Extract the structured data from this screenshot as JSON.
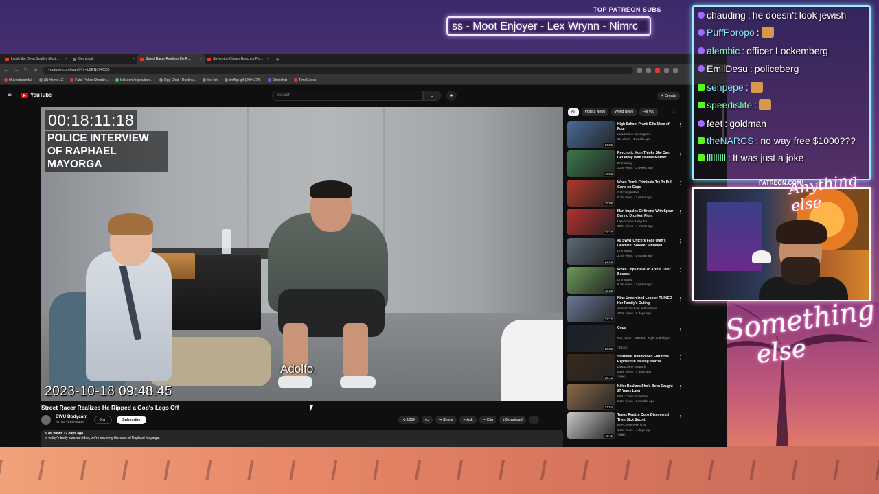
{
  "overlay": {
    "patreon_label": "TOP PATREON SUBS",
    "ticker_text": "ss - Moot Enjoyer - Lex Wrynn - Nimrc",
    "webcam_patreon": "PATREON.COM/",
    "webcam_brand": "Anything else",
    "logo_line1": "Something",
    "logo_line2": "else"
  },
  "chat": {
    "messages": [
      {
        "user": "chauding",
        "text": "he doesn't look jewish",
        "platform": "t"
      },
      {
        "user": "PuffPoropo",
        "text": "",
        "platform": "t"
      },
      {
        "user": "alembic",
        "text": "officer Lockemberg",
        "platform": "t"
      },
      {
        "user": "EmilDesu",
        "text": "policeberg",
        "platform": "t"
      },
      {
        "user": "senpepe",
        "text": "",
        "platform": "k"
      },
      {
        "user": "speedislife",
        "text": "",
        "platform": "k"
      },
      {
        "user": "feet",
        "text": "goldman",
        "platform": "t"
      },
      {
        "user": "theNARCS",
        "text": "no way free $1000???",
        "platform": "k"
      },
      {
        "user": "lllllllll",
        "text": "It was just a joke",
        "platform": "k"
      }
    ]
  },
  "browser": {
    "tabs": [
      {
        "label": "Inside the Deep South's Most ..."
      },
      {
        "label": "Omnichat"
      },
      {
        "label": "Street Racer Realizes He R..."
      },
      {
        "label": "Sovereign Citizen Reaches For..."
      }
    ],
    "url": "youtube.com/watch?v=LZENij74CZ8",
    "bookmarks": [
      "r/Livestreamfail",
      "(3) Home / X",
      "Fatal Police Shootin...",
      "kick.com/popout/an...",
      "Dgg Chat - Destiny...",
      "the list",
      "enffigs-gif (399×278)",
      "Omnichat",
      "TimeGuess"
    ]
  },
  "youtube": {
    "logo_text": "YouTube",
    "search_placeholder": "Search",
    "create_label": "+ Create",
    "video": {
      "timecode": "00:18:11:18",
      "overlay_title": "POLICE INTERVIEW OF RAPHAEL MAYORGA",
      "date_stamp": "2023-10-18  09:48:45",
      "caption": "Adolfo.",
      "title": "Street Racer Realizes He Ripped a Cop's Legs Off",
      "channel": "EWU Bodycam",
      "subscribers": "3.07M subscribers",
      "join_label": "Join",
      "subscribe_label": "Subscribe",
      "likes": "101K",
      "share_label": "Share",
      "ask_label": "Ask",
      "clip_label": "Clip",
      "download_label": "Download",
      "desc_meta": "3.7M views  12 days ago",
      "desc_line": "In today's body camera video, we're covering the case of Raphael Mayorga."
    },
    "chips": [
      "All",
      "Politics News",
      "World News",
      "For you"
    ],
    "recommendations": [
      {
        "title": "High School Prank Kills Mom of Four",
        "channel": "Law&Crime Investigates",
        "meta": "8M views · 4 weeks ago",
        "duration": "36:05",
        "badge": "",
        "color": "#4a6a9a"
      },
      {
        "title": "Psychotic Mom Thinks She Can Get Away With Double Murder",
        "channel": "Dr Insanity",
        "meta": "3.3M views · 2 weeks ago",
        "duration": "49:03",
        "badge": "",
        "color": "#3a7a4a"
      },
      {
        "title": "When Dumb Criminals Try To Pull Guns on Cops",
        "channel": "Catching Killers",
        "meta": "6.1M views · 2 years ago",
        "duration": "19:08",
        "badge": "",
        "color": "#b23a2a"
      },
      {
        "title": "Man Impales Girlfriend With Spear During Drunken Fight",
        "channel": "Law&Crime Bodycam",
        "meta": "302K views · 1 month ago",
        "duration": "22:17",
        "badge": "",
        "color": "#b83030"
      },
      {
        "title": "40 SWAT Officers Face Utah's Deadliest Shooter Situation",
        "channel": "Dr Insanity",
        "meta": "2.7M views · 1 month ago",
        "duration": "23:43",
        "badge": "",
        "color": "#5a6a7a"
      },
      {
        "title": "When Cops Have To Arrest Their Bosses",
        "channel": "Dr Insanity",
        "meta": "6.1M views · 2 years ago",
        "duration": "16:58",
        "badge": "",
        "color": "#6a9a5a"
      },
      {
        "title": "Nine Undersized Lobster RUINED Her Family's Outing",
        "channel": "Arrest Cam Fish and Wildlife",
        "meta": "425K views · 8 days ago",
        "duration": "23:17",
        "badge": "",
        "color": "#6a7a9a"
      },
      {
        "title": "Cops",
        "channel": "Fox Nation · S26 E1 · Fight and Flight",
        "meta": "",
        "duration": "20:35",
        "badge": "TV-14",
        "color": "#1a2030"
      },
      {
        "title": "Shirtless, Blindfolded Frat Bros Exposed In 'Hazing' Horror",
        "channel": "Law&Crime Network",
        "meta": "848K views · 4 days ago",
        "duration": "29:12",
        "badge": "New",
        "color": "#3a2a1a"
      },
      {
        "title": "Killer Realizes She's Been Caught 27 Years Later",
        "channel": "EWU Crime Storytime",
        "meta": "2.3M views · 2 months ago",
        "duration": "27:54",
        "badge": "",
        "color": "#8a6a4a"
      },
      {
        "title": "Teens Realize Cops Discovered Their Sick Secret",
        "channel": "EXPLORE WITH US",
        "meta": "1.7M views · 4 days ago",
        "duration": "48:11",
        "badge": "New",
        "color": "#c8c8c8"
      }
    ]
  }
}
